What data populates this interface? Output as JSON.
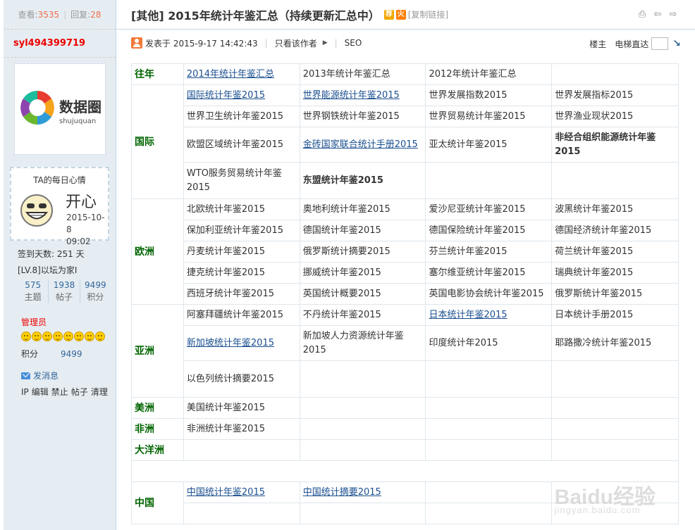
{
  "sidebar": {
    "views_label": "查看:",
    "views": "3535",
    "replies_label": "回复:",
    "replies": "28",
    "author": "syl494399719",
    "avatar_logo_text": "数据圈",
    "avatar_logo_sub": "shujuquan",
    "mood_title": "TA的每日心情",
    "mood": "开心",
    "mood_date": "2015-10-8",
    "mood_time": "09:02",
    "signin_days": "签到天数: 251 天",
    "level": "[LV.8]以坛为家I",
    "stats": [
      {
        "value": "575",
        "label": "主题"
      },
      {
        "value": "1938",
        "label": "帖子"
      },
      {
        "value": "9499",
        "label": "积分"
      }
    ],
    "role": "管理员",
    "points_label": "积分",
    "points": "9499",
    "send_message": "发消息",
    "admin_links": [
      "IP",
      "编辑",
      "禁止",
      "帖子",
      "清理"
    ]
  },
  "thread": {
    "title": "[其他] 2015年统计年鉴汇总（持续更新汇总中）",
    "badge_recommend": "荐",
    "badge_hot": "火",
    "copy_link": "[复制链接]",
    "posted": "发表于 2015-9-17 14:42:43",
    "only_author": "只看该作者",
    "seo": "SEO",
    "floor": "楼主",
    "elevator": "电梯直达"
  },
  "table": {
    "rows": [
      {
        "region": "往年",
        "cells": [
          "2014年统计年鉴汇总",
          "2013年统计年鉴汇总",
          "2012年统计年鉴汇总",
          ""
        ]
      },
      {
        "region": "国际",
        "cells": [
          "国际统计年鉴2015",
          "世界能源统计年鉴2015",
          "世界发展指数2015",
          "世界发展指标2015"
        ]
      },
      {
        "cells": [
          "世界卫生统计年鉴2015",
          "世界钢铁统计年鉴2015",
          "世界贸易统计年鉴2015",
          "世界渔业现状2015"
        ]
      },
      {
        "cells": [
          "欧盟区域统计年鉴2015",
          "金砖国家联合统计手册2015",
          "亚太统计年鉴2015",
          "非经合组织能源统计年鉴2015"
        ]
      },
      {
        "cells": [
          "WTO服务贸易统计年鉴2015",
          "东盟统计年鉴2015",
          "",
          ""
        ]
      },
      {
        "region": "欧洲",
        "cells": [
          "北欧统计年鉴2015",
          "奥地利统计年鉴2015",
          "爱沙尼亚统计年鉴2015",
          "波黑统计年鉴2015"
        ]
      },
      {
        "cells": [
          "保加利亚统计年鉴2015",
          "德国统计年鉴2015",
          "德国保险统计年鉴2015",
          "德国经济统计年鉴2015"
        ]
      },
      {
        "cells": [
          "丹麦统计年鉴2015",
          "俄罗斯统计摘要2015",
          "芬兰统计年鉴2015",
          "荷兰统计年鉴2015"
        ]
      },
      {
        "cells": [
          "捷克统计年鉴2015",
          "挪威统计年鉴2015",
          "塞尔维亚统计年鉴2015",
          "瑞典统计年鉴2015"
        ]
      },
      {
        "cells": [
          "西班牙统计年鉴2015",
          "英国统计概要2015",
          "英国电影协会统计年鉴2015",
          "俄罗斯统计年鉴2015"
        ]
      },
      {
        "region": "亚洲",
        "cells": [
          "阿塞拜疆统计年鉴2015",
          "不丹统计年鉴2015",
          "日本统计年鉴2015",
          "日本统计手册2015"
        ]
      },
      {
        "cells": [
          "新加坡统计年鉴2015",
          "新加坡人力资源统计年鉴2015",
          "印度统计年2015",
          "耶路撒冷统计年鉴2015"
        ]
      },
      {
        "cells": [
          "以色列统计摘要2015",
          "",
          "",
          ""
        ]
      },
      {
        "region": "美洲",
        "cells": [
          "美国统计年鉴2015",
          "",
          "",
          ""
        ]
      },
      {
        "region": "非洲",
        "cells": [
          "非洲统计年鉴2015",
          "",
          "",
          ""
        ]
      },
      {
        "region": "大洋洲",
        "cells": [
          "",
          "",
          "",
          ""
        ]
      },
      {
        "region": "中国",
        "cells": [
          "中国统计年鉴2015",
          "中国统计摘要2015",
          "",
          ""
        ]
      }
    ]
  },
  "watermark": {
    "text": "Baidu经验",
    "sub": "jingyan.baidu.com"
  }
}
